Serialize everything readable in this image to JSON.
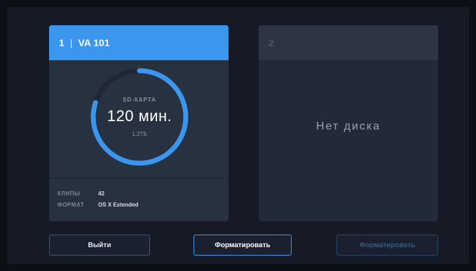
{
  "slots": [
    {
      "number": "1",
      "separator": "|",
      "name": "VA 101",
      "ring": {
        "label": "SD-КАРТА",
        "time": "120 мин.",
        "size": "1,2ТБ",
        "fill_fraction": 0.8,
        "color": "#3b97ee",
        "track_color": "#1f2735"
      },
      "info": [
        {
          "key": "КЛИПЫ",
          "value": "42"
        },
        {
          "key": "ФОРМАТ",
          "value": "OS X Extended"
        }
      ]
    },
    {
      "number": "2",
      "status": "Нет диска"
    }
  ],
  "buttons": {
    "exit": "Выйти",
    "format_slot1": "Форматировать",
    "format_slot2": "Форматировать"
  },
  "colors": {
    "accent": "#3b97ee",
    "background": "#151a26"
  }
}
